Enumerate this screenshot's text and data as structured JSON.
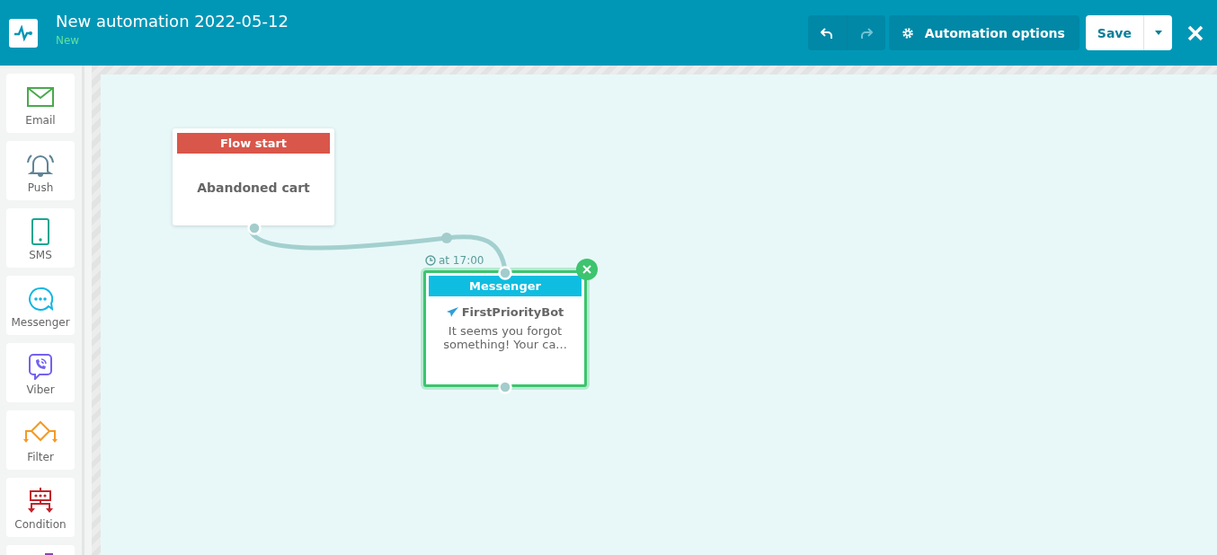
{
  "header": {
    "title": "New automation 2022-05-12",
    "status": "New"
  },
  "toolbar": {
    "undo": {
      "disabled": false
    },
    "redo": {
      "disabled": true
    },
    "options_button": "Automation options",
    "save_button": "Save"
  },
  "palette": [
    {
      "kind": "email",
      "label": "Email"
    },
    {
      "kind": "push",
      "label": "Push"
    },
    {
      "kind": "sms",
      "label": "SMS"
    },
    {
      "kind": "messenger",
      "label": "Messenger"
    },
    {
      "kind": "viber",
      "label": "Viber"
    },
    {
      "kind": "filter",
      "label": "Filter"
    },
    {
      "kind": "condition",
      "label": "Condition"
    },
    {
      "kind": "other"
    }
  ],
  "nodes": [
    {
      "kind": "start",
      "title": "Flow start",
      "body": "Abandoned cart",
      "selected": false,
      "color": "#d9564a"
    },
    {
      "kind": "message",
      "title": "Messenger",
      "schedule": "at 17:00",
      "sender": "FirstPriorityBot",
      "body": "It seems you forgot something! Your ca...",
      "selected": true,
      "color": "#0fbde0"
    }
  ]
}
